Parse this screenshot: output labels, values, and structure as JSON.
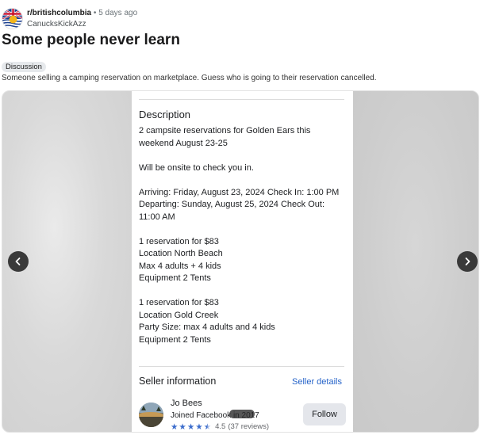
{
  "post": {
    "subreddit": "r/britishcolumbia",
    "separator": "•",
    "time_ago": "5 days ago",
    "author": "CanucksKickAzz",
    "title": "Some people never learn",
    "flair": "Discussion",
    "body": "Someone selling a camping reservation on marketplace. Guess who is going to their reservation cancelled."
  },
  "listing": {
    "description_title": "Description",
    "paragraphs": [
      "2 campsite reservations for Golden Ears this weekend August 23-25",
      "Will be onsite to check you in.",
      "Arriving: Friday, August 23, 2024 Check In: 1:00 PM\nDeparting: Sunday, August 25, 2024 Check Out: 11:00 AM",
      "1 reservation for $83\nLocation North Beach\nMax 4 adults + 4 kids\nEquipment 2 Tents",
      "1 reservation for $83\nLocation Gold Creek\nParty Size: max 4 adults and 4 kids\nEquipment 2 Tents"
    ],
    "seller_info_title": "Seller information",
    "seller_details_link": "Seller details",
    "seller_name": "Jo Bees",
    "joined_text": "Joined Facebook in 2017",
    "rating_value": "4.5",
    "rating_reviews": "(37 reviews)",
    "rating_stars": 4.5,
    "follow_label": "Follow"
  },
  "colors": {
    "accent_link": "#2563c9",
    "star": "#3b6ccc",
    "nav_button": "#3a3a3a"
  },
  "icons": {
    "subreddit_avatar": "bc-flag-icon",
    "prev": "chevron-left-icon",
    "next": "chevron-right-icon",
    "star": "star-icon"
  }
}
